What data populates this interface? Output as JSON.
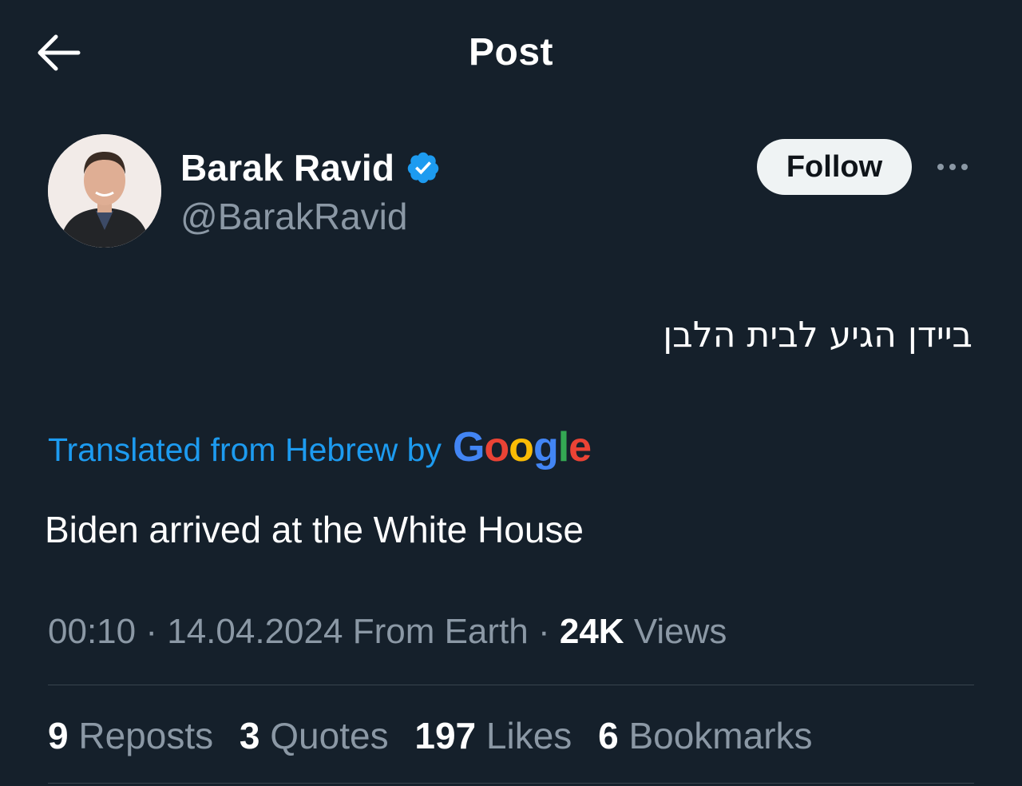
{
  "header": {
    "title": "Post",
    "back_icon": "arrow-left-icon"
  },
  "author": {
    "name": "Barak Ravid",
    "handle": "@BarakRavid",
    "verified": true,
    "verified_color": "#1d9bf0",
    "avatar_icon": "profile-photo"
  },
  "follow_button": {
    "label": "Follow"
  },
  "more_icon": "ellipsis-icon",
  "post": {
    "original_text": "ביידן הגיע לבית הלבן",
    "translated_label": "Translated from Hebrew by",
    "translator_logo": "Google",
    "translated_text": "Biden arrived at the White House"
  },
  "meta": {
    "time": "00:10",
    "sep1": "·",
    "date": "14.04.2024",
    "source": "From Earth",
    "sep2": "·",
    "views_count": "24K",
    "views_label": "Views"
  },
  "stats": [
    {
      "count": "9",
      "label": "Reposts"
    },
    {
      "count": "3",
      "label": "Quotes"
    },
    {
      "count": "197",
      "label": "Likes"
    },
    {
      "count": "6",
      "label": "Bookmarks"
    }
  ],
  "colors": {
    "background": "#15202b",
    "accent": "#1d9bf0",
    "secondary_text": "#8b98a5",
    "divider": "#38444d",
    "google_blue": "#4285f4",
    "google_red": "#ea4335",
    "google_yellow": "#fbbc05",
    "google_green": "#34a853"
  }
}
